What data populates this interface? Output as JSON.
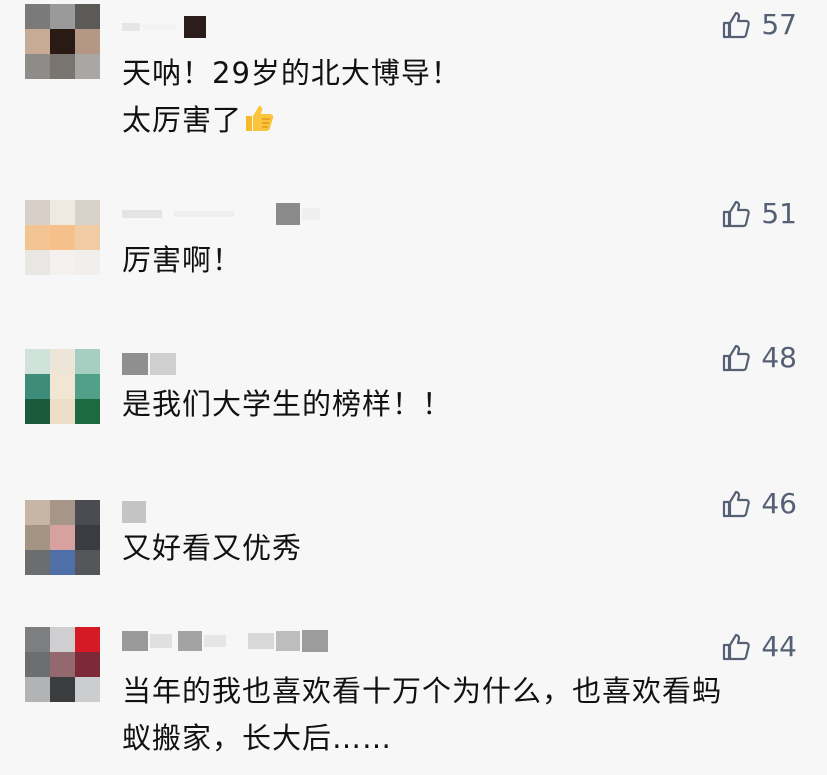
{
  "comments": [
    {
      "text_lines": [
        "天呐！29岁的北大博导！",
        "太厉害了"
      ],
      "emoji": "thumbs-up-emoji",
      "likes": "57",
      "avatar_colors": [
        "#7a7a7a",
        "#9a9a9a",
        "#5c5a57",
        "#c8ab95",
        "#2a1a14",
        "#b49784",
        "#8d8c88",
        "#7a7471",
        "#a9a7a4"
      ]
    },
    {
      "text_lines": [
        "厉害啊！"
      ],
      "likes": "51",
      "avatar_colors": [
        "#d8cfc8",
        "#efe9e3",
        "#d9d2cb",
        "#f3c493",
        "#f6c08a",
        "#f0cba3",
        "#e9e7e4",
        "#f4f1ee",
        "#f1eeeb"
      ]
    },
    {
      "text_lines": [
        "是我们大学生的榜样！！"
      ],
      "likes": "48",
      "avatar_colors": [
        "#d0e3da",
        "#ece5d8",
        "#a7cfc1",
        "#3e8c7a",
        "#f0e6d3",
        "#51a08a",
        "#1c5a3c",
        "#eddfc7",
        "#1d6940"
      ]
    },
    {
      "text_lines": [
        "又好看又优秀"
      ],
      "likes": "46",
      "avatar_colors": [
        "#c7b6a6",
        "#a6968a",
        "#4b4c51",
        "#a39483",
        "#d6a19f",
        "#3a3c42",
        "#6c6d6f",
        "#4f6fa9",
        "#55565a"
      ]
    },
    {
      "text_lines": [
        "当年的我也喜欢看十万个为什么，也喜欢看蚂",
        "蚁搬家，长大后……"
      ],
      "likes": "44",
      "avatar_colors": [
        "#7d7e80",
        "#cfcfd1",
        "#d51a25",
        "#6d6e70",
        "#93686f",
        "#7c2a38",
        "#b2b3b5",
        "#3b3c3e",
        "#cccdcf"
      ]
    }
  ],
  "like_icon": "thumb-up-outline-icon"
}
